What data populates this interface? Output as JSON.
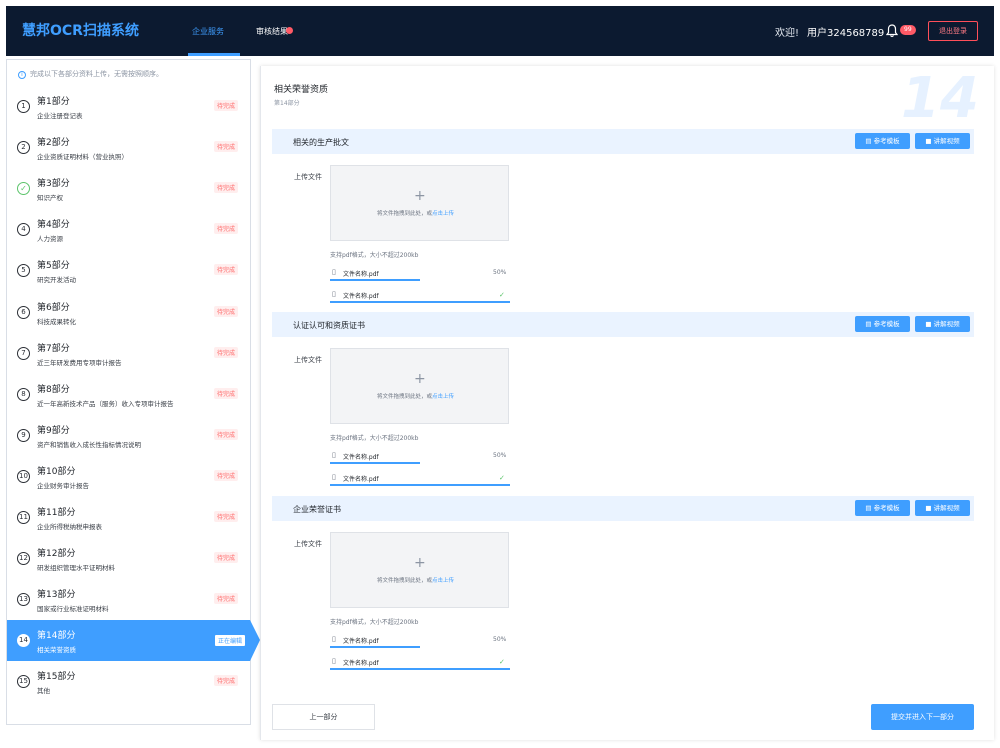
{
  "header": {
    "app_title": "慧邦OCR扫描系统",
    "nav": [
      {
        "label": "企业服务"
      },
      {
        "label": "审核结果"
      }
    ],
    "welcome": "欢迎!",
    "username": "用户324568789",
    "notification_count": "99",
    "logout_label": "退出登录"
  },
  "sidebar": {
    "tip": "完成以下各部分资料上传，无需按照顺序。",
    "tip_icon": "i",
    "steps": [
      {
        "num": "1",
        "title": "第1部分",
        "sub": "企业注册登记表",
        "status": "待完成"
      },
      {
        "num": "2",
        "title": "第2部分",
        "sub": "企业资质证明材料（营业执照）",
        "status": "待完成"
      },
      {
        "num": "✓",
        "title": "第3部分",
        "sub": "知识产权",
        "status": "待完成"
      },
      {
        "num": "4",
        "title": "第4部分",
        "sub": "人力资源",
        "status": "待完成"
      },
      {
        "num": "5",
        "title": "第5部分",
        "sub": "研究开发活动",
        "status": "待完成"
      },
      {
        "num": "6",
        "title": "第6部分",
        "sub": "科技成果转化",
        "status": "待完成"
      },
      {
        "num": "7",
        "title": "第7部分",
        "sub": "近三年研发费用专项审计报告",
        "status": "待完成"
      },
      {
        "num": "8",
        "title": "第8部分",
        "sub": "近一年高新技术产品（服务）收入专项审计报告",
        "status": "待完成"
      },
      {
        "num": "9",
        "title": "第9部分",
        "sub": "资产和销售收入成长性指标情况说明",
        "status": "待完成"
      },
      {
        "num": "10",
        "title": "第10部分",
        "sub": "企业财务审计报告",
        "status": "待完成"
      },
      {
        "num": "11",
        "title": "第11部分",
        "sub": "企业所得税纳税申报表",
        "status": "待完成"
      },
      {
        "num": "12",
        "title": "第12部分",
        "sub": "研发组织管理水平证明材料",
        "status": "待完成"
      },
      {
        "num": "13",
        "title": "第13部分",
        "sub": "国家或行业标准证明材料",
        "status": "待完成"
      },
      {
        "num": "14",
        "title": "第14部分",
        "sub": "相关荣誉资质",
        "status": "正在编辑"
      },
      {
        "num": "15",
        "title": "第15部分",
        "sub": "其他",
        "status": "待完成"
      }
    ]
  },
  "main": {
    "title": "相关荣誉资质",
    "subtitle": "第14部分",
    "big_number": "14",
    "upload_label": "上传文件",
    "dropzone_text": "将文件拖拽到此处，或",
    "dropzone_link": "点击上传",
    "format_hint": "支持pdf格式，大小不超过200kb",
    "ref_btn": "参考模板",
    "video_btn": "讲解视频",
    "sections": [
      {
        "title": "相关的生产批文",
        "files": [
          {
            "name": "文件名称.pdf",
            "progress": "50%"
          },
          {
            "name": "文件名称.pdf",
            "progress": "done"
          }
        ]
      },
      {
        "title": "认证认可和资质证书",
        "files": [
          {
            "name": "文件名称.pdf",
            "progress": "50%"
          },
          {
            "name": "文件名称.pdf",
            "progress": "done"
          }
        ]
      },
      {
        "title": "企业荣誉证书",
        "files": [
          {
            "name": "文件名称.pdf",
            "progress": "50%"
          },
          {
            "name": "文件名称.pdf",
            "progress": "done"
          }
        ]
      }
    ],
    "prev_btn": "上一部分",
    "next_btn": "提交并进入下一部分"
  }
}
